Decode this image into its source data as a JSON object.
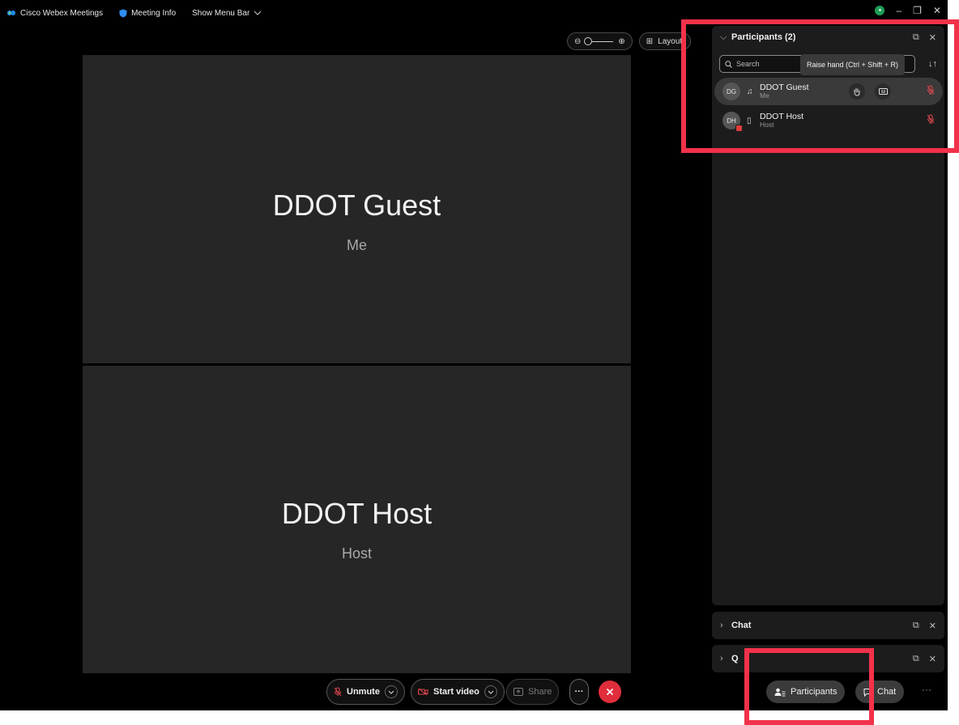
{
  "titlebar": {
    "app_name": "Cisco Webex Meetings",
    "meeting_info": "Meeting Info",
    "menu_toggle": "Show Menu Bar"
  },
  "view_toolbar": {
    "layout_label": "Layout"
  },
  "stage": {
    "tiles": [
      {
        "name": "DDOT Guest",
        "subtitle": "Me"
      },
      {
        "name": "DDOT Host",
        "subtitle": "Host"
      }
    ]
  },
  "participants_panel": {
    "title": "Participants (2)",
    "search_placeholder": "Search",
    "tooltip": "Raise hand (Ctrl + Shift + R)",
    "rows": [
      {
        "initials": "DG",
        "name": "DDOT Guest",
        "role": "Me"
      },
      {
        "initials": "DH",
        "name": "DDOT Host",
        "role": "Host"
      }
    ]
  },
  "chat_panel": {
    "title": "Chat"
  },
  "qa_panel": {
    "title": "Q"
  },
  "bottom_bar": {
    "unmute_label": "Unmute",
    "video_label": "Start video",
    "share_label": "Share",
    "participants_label": "Participants",
    "chat_label": "Chat"
  },
  "colors": {
    "background": "#000000",
    "tile": "#262626",
    "panel": "#1c1c1c",
    "end_call": "#e02d3c",
    "annotation": "#f2324a"
  }
}
